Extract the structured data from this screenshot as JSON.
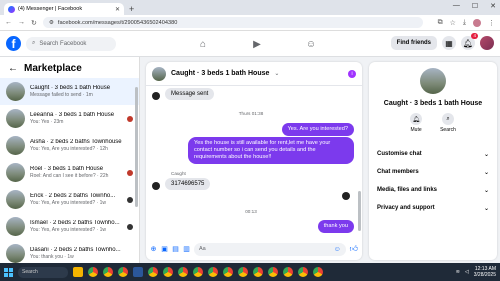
{
  "browser": {
    "tab_title": "(4) Messenger | Facebook",
    "url": "facebook.com/messages/t/29005436502404380"
  },
  "fb": {
    "search_placeholder": "Search Facebook",
    "find_friends": "Find friends",
    "notif_count": "4"
  },
  "sidebar": {
    "title": "Marketplace",
    "items": [
      {
        "name": "Caught · 3 beds 1 bath House",
        "preview": "Message failed to send · 1m",
        "dot": "none"
      },
      {
        "name": "Leeanna · 3 beds 1 bath House",
        "preview": "You: Yes · 23m",
        "dot": "red"
      },
      {
        "name": "Aisha · 2 beds 2 baths Townhouse",
        "preview": "You: Yes, Are you interested? · 12h",
        "dot": "none"
      },
      {
        "name": "Roel · 3 beds 1 bath House",
        "preview": "Roel: And can I see it before? · 22h",
        "dot": "red"
      },
      {
        "name": "Erick · 2 beds 2 baths Townho...",
        "preview": "You: Yes, Are you interested? · 1w",
        "dot": "dark"
      },
      {
        "name": "Ismael · 2 beds 2 baths Townho...",
        "preview": "You: Yes, Are you interested? · 1w",
        "dot": "dark"
      },
      {
        "name": "Dasani · 2 beds 2 baths Townho...",
        "preview": "You: thank you · 1w",
        "dot": "none"
      }
    ]
  },
  "chat": {
    "title": "Caught · 3 beds 1 bath House",
    "m1": "Message sent",
    "ts1": "Thurs 01:38",
    "m2": "Yes. Are you interested?",
    "m3": "Yes the house is still available for rent,let me have your contact number so i can send you details and the requirements about the house!!",
    "sender": "Caught",
    "m4": "3174696575",
    "ts2": "00:13",
    "m5": "thank you",
    "input_placeholder": "Aa"
  },
  "info": {
    "name": "Caught · 3 beds 1 bath House",
    "mute": "Mute",
    "search": "Search",
    "sections": [
      "Customise chat",
      "Chat members",
      "Media, files and links",
      "Privacy and support"
    ]
  },
  "taskbar": {
    "search": "Search",
    "time": "12:13 AM",
    "date": "3/28/2025"
  }
}
